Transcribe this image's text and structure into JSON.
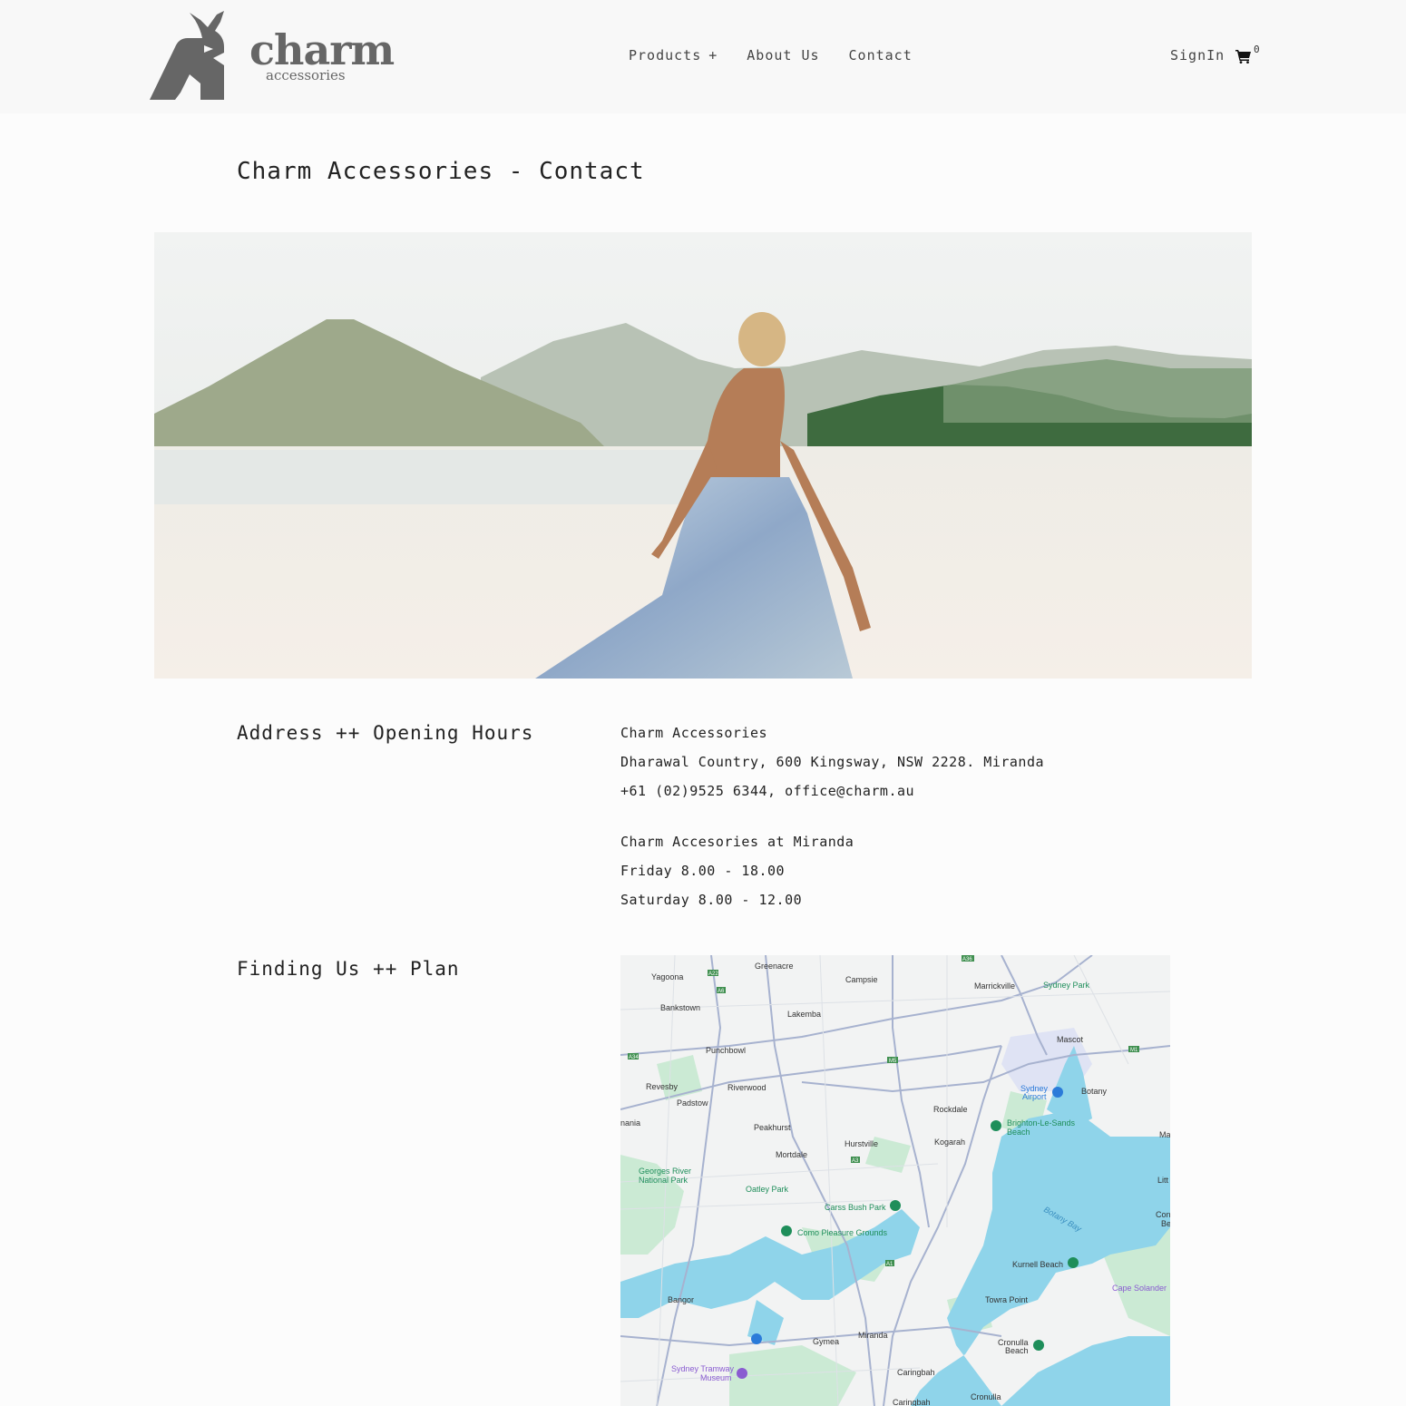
{
  "header": {
    "logo": {
      "word": "charm",
      "sub": "accessories"
    },
    "nav": [
      {
        "label": "Products",
        "suffix": "+"
      },
      {
        "label": "About Us"
      },
      {
        "label": "Contact"
      }
    ],
    "signin_label": "SignIn",
    "cart_count": "0"
  },
  "page_title": "Charm Accessories - Contact",
  "address_section": {
    "heading": "Address ++ Opening Hours",
    "lines": [
      "Charm Accessories",
      "Dharawal Country, 600 Kingsway, NSW 2228. Miranda",
      "+61 (02)9525 6344, office@charm.au"
    ],
    "hours": [
      "Charm Accesories at Miranda",
      "Friday 8.00 - 18.00",
      "Saturday 8.00 - 12.00"
    ]
  },
  "map_section": {
    "heading": "Finding Us ++ Plan",
    "labels": {
      "yagoona": "Yagoona",
      "greenacre": "Greenacre",
      "campsie": "Campsie",
      "marrickville": "Marrickville",
      "sydney_park": "Sydney Park",
      "bankstown": "Bankstown",
      "lakemba": "Lakemba",
      "mascot": "Mascot",
      "punchbowl": "Punchbowl",
      "revesby": "Revesby",
      "riverwood": "Riverwood",
      "sydney_airport_1": "Sydney",
      "sydney_airport_2": "Airport",
      "botany": "Botany",
      "padstow": "Padstow",
      "rockdale": "Rockdale",
      "menai": "nania",
      "peakhurst": "Peakhurst",
      "brighton_1": "Brighton-Le-Sands",
      "brighton_2": "Beach",
      "hurstville": "Hurstville",
      "kogarah": "Kogarah",
      "mortdale": "Mortdale",
      "georges_river_1": "Georges River",
      "georges_river_2": "National Park",
      "oatley_park": "Oatley Park",
      "carss_bush_park": "Carss Bush Park",
      "como_pleasure": "Como Pleasure Grounds",
      "botany_bay": "Botany Bay",
      "kurnell_beach": "Kurnell Beach",
      "cape_solander": "Cape Solander",
      "towra_point": "Towra Point",
      "bangor": "Bangor",
      "gymea": "Gymea",
      "miranda": "Miranda",
      "cronulla_beach_1": "Cronulla",
      "cronulla_beach_2": "Beach",
      "tramway_1": "Sydney Tramway",
      "tramway_2": "Museum",
      "caringbah": "Caringbah",
      "caringbah_2": "Caringbah",
      "cronulla": "Cronulla",
      "ma": "Ma",
      "litt": "Litt",
      "congw_1": "Congw",
      "congw_2": "Be",
      "route_a22": "A22",
      "route_a6": "A6",
      "route_a34": "A34",
      "route_a36": "A36",
      "route_m5": "M5",
      "route_m1": "M1",
      "route_a1": "A1",
      "route_a3": "A3"
    }
  },
  "colors": {
    "header_bg": "#f8f8f8",
    "page_bg": "#fcfcfc",
    "logo_grey": "#666666",
    "water": "#8fd4ea",
    "park": "#c9ecd2",
    "road": "#9aa8c6"
  }
}
